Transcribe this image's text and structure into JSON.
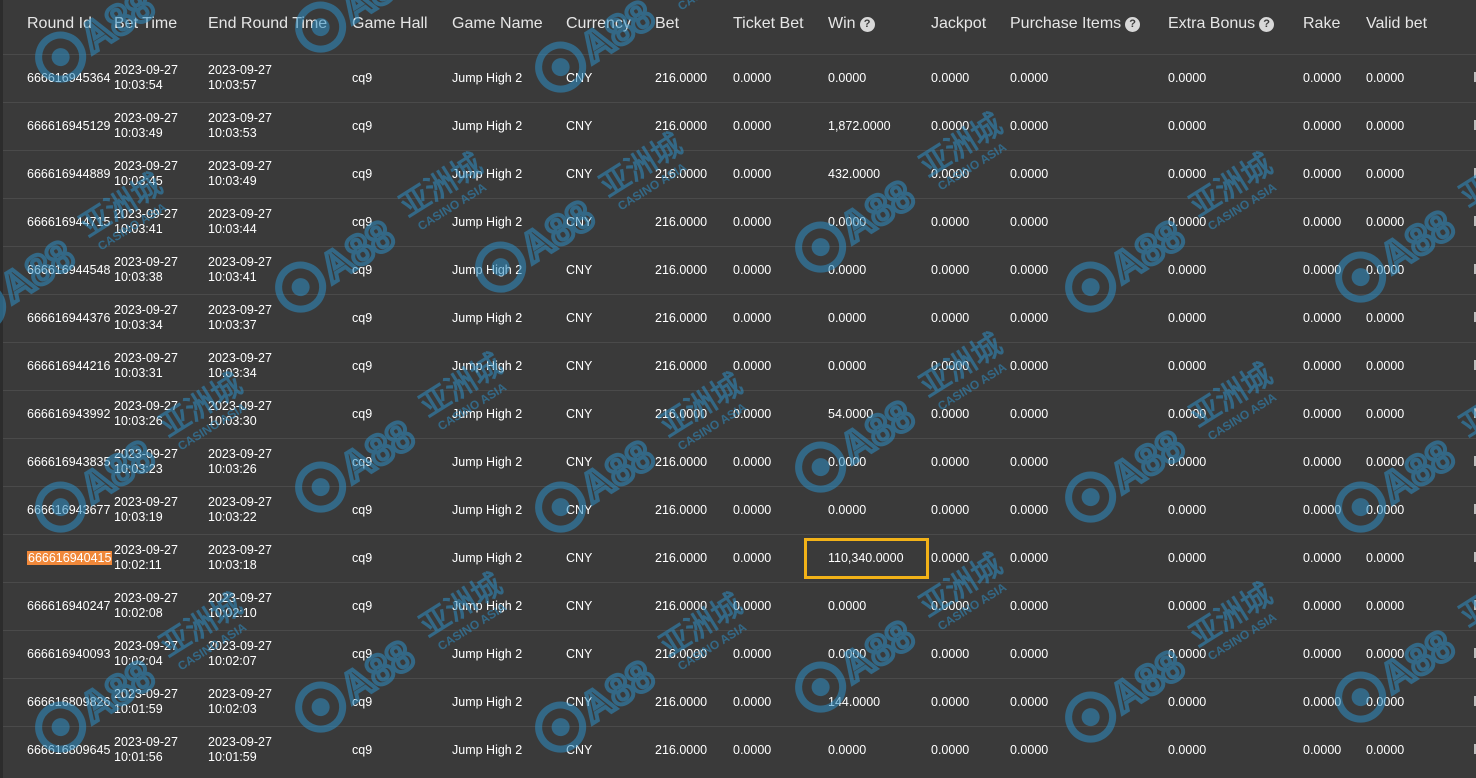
{
  "table": {
    "columns": [
      {
        "label": "Round Id",
        "help": false
      },
      {
        "label": "Bet Time",
        "help": false
      },
      {
        "label": "End Round Time",
        "help": false
      },
      {
        "label": "Game Hall",
        "help": false
      },
      {
        "label": "Game Name",
        "help": false
      },
      {
        "label": "Currency",
        "help": false
      },
      {
        "label": "Bet",
        "help": false
      },
      {
        "label": "Ticket Bet",
        "help": false
      },
      {
        "label": "Win",
        "help": true
      },
      {
        "label": "Jackpot",
        "help": false
      },
      {
        "label": "Purchase Items",
        "help": true
      },
      {
        "label": "Extra Bonus",
        "help": true
      },
      {
        "label": "Rake",
        "help": false
      },
      {
        "label": "Valid bet",
        "help": false
      }
    ],
    "help_glyph": "?",
    "rows": [
      {
        "round_id": "666616945364",
        "bet_date": "2023-09-27",
        "bet_clock": "10:03:54",
        "end_date": "2023-09-27",
        "end_clock": "10:03:57",
        "hall": "cq9",
        "game": "Jump High 2",
        "currency": "CNY",
        "bet": "216.0000",
        "ticket_bet": "0.0000",
        "win": "0.0000",
        "jackpot": "0.0000",
        "purchase": "0.0000",
        "extra_bonus": "0.0000",
        "rake": "0.0000",
        "valid_bet": "0.0000"
      },
      {
        "round_id": "666616945129",
        "bet_date": "2023-09-27",
        "bet_clock": "10:03:49",
        "end_date": "2023-09-27",
        "end_clock": "10:03:53",
        "hall": "cq9",
        "game": "Jump High 2",
        "currency": "CNY",
        "bet": "216.0000",
        "ticket_bet": "0.0000",
        "win": "1,872.0000",
        "jackpot": "0.0000",
        "purchase": "0.0000",
        "extra_bonus": "0.0000",
        "rake": "0.0000",
        "valid_bet": "0.0000"
      },
      {
        "round_id": "666616944889",
        "bet_date": "2023-09-27",
        "bet_clock": "10:03:45",
        "end_date": "2023-09-27",
        "end_clock": "10:03:49",
        "hall": "cq9",
        "game": "Jump High 2",
        "currency": "CNY",
        "bet": "216.0000",
        "ticket_bet": "0.0000",
        "win": "432.0000",
        "jackpot": "0.0000",
        "purchase": "0.0000",
        "extra_bonus": "0.0000",
        "rake": "0.0000",
        "valid_bet": "0.0000"
      },
      {
        "round_id": "666616944715",
        "bet_date": "2023-09-27",
        "bet_clock": "10:03:41",
        "end_date": "2023-09-27",
        "end_clock": "10:03:44",
        "hall": "cq9",
        "game": "Jump High 2",
        "currency": "CNY",
        "bet": "216.0000",
        "ticket_bet": "0.0000",
        "win": "0.0000",
        "jackpot": "0.0000",
        "purchase": "0.0000",
        "extra_bonus": "0.0000",
        "rake": "0.0000",
        "valid_bet": "0.0000"
      },
      {
        "round_id": "666616944548",
        "bet_date": "2023-09-27",
        "bet_clock": "10:03:38",
        "end_date": "2023-09-27",
        "end_clock": "10:03:41",
        "hall": "cq9",
        "game": "Jump High 2",
        "currency": "CNY",
        "bet": "216.0000",
        "ticket_bet": "0.0000",
        "win": "0.0000",
        "jackpot": "0.0000",
        "purchase": "0.0000",
        "extra_bonus": "0.0000",
        "rake": "0.0000",
        "valid_bet": "0.0000"
      },
      {
        "round_id": "666616944376",
        "bet_date": "2023-09-27",
        "bet_clock": "10:03:34",
        "end_date": "2023-09-27",
        "end_clock": "10:03:37",
        "hall": "cq9",
        "game": "Jump High 2",
        "currency": "CNY",
        "bet": "216.0000",
        "ticket_bet": "0.0000",
        "win": "0.0000",
        "jackpot": "0.0000",
        "purchase": "0.0000",
        "extra_bonus": "0.0000",
        "rake": "0.0000",
        "valid_bet": "0.0000"
      },
      {
        "round_id": "666616944216",
        "bet_date": "2023-09-27",
        "bet_clock": "10:03:31",
        "end_date": "2023-09-27",
        "end_clock": "10:03:34",
        "hall": "cq9",
        "game": "Jump High 2",
        "currency": "CNY",
        "bet": "216.0000",
        "ticket_bet": "0.0000",
        "win": "0.0000",
        "jackpot": "0.0000",
        "purchase": "0.0000",
        "extra_bonus": "0.0000",
        "rake": "0.0000",
        "valid_bet": "0.0000"
      },
      {
        "round_id": "666616943992",
        "bet_date": "2023-09-27",
        "bet_clock": "10:03:26",
        "end_date": "2023-09-27",
        "end_clock": "10:03:30",
        "hall": "cq9",
        "game": "Jump High 2",
        "currency": "CNY",
        "bet": "216.0000",
        "ticket_bet": "0.0000",
        "win": "54.0000",
        "jackpot": "0.0000",
        "purchase": "0.0000",
        "extra_bonus": "0.0000",
        "rake": "0.0000",
        "valid_bet": "0.0000"
      },
      {
        "round_id": "666616943835",
        "bet_date": "2023-09-27",
        "bet_clock": "10:03:23",
        "end_date": "2023-09-27",
        "end_clock": "10:03:26",
        "hall": "cq9",
        "game": "Jump High 2",
        "currency": "CNY",
        "bet": "216.0000",
        "ticket_bet": "0.0000",
        "win": "0.0000",
        "jackpot": "0.0000",
        "purchase": "0.0000",
        "extra_bonus": "0.0000",
        "rake": "0.0000",
        "valid_bet": "0.0000"
      },
      {
        "round_id": "666616943677",
        "bet_date": "2023-09-27",
        "bet_clock": "10:03:19",
        "end_date": "2023-09-27",
        "end_clock": "10:03:22",
        "hall": "cq9",
        "game": "Jump High 2",
        "currency": "CNY",
        "bet": "216.0000",
        "ticket_bet": "0.0000",
        "win": "0.0000",
        "jackpot": "0.0000",
        "purchase": "0.0000",
        "extra_bonus": "0.0000",
        "rake": "0.0000",
        "valid_bet": "0.0000"
      },
      {
        "round_id": "666616940415",
        "bet_date": "2023-09-27",
        "bet_clock": "10:02:11",
        "end_date": "2023-09-27",
        "end_clock": "10:03:18",
        "hall": "cq9",
        "game": "Jump High 2",
        "currency": "CNY",
        "bet": "216.0000",
        "ticket_bet": "0.0000",
        "win": "110,340.0000",
        "jackpot": "0.0000",
        "purchase": "0.0000",
        "extra_bonus": "0.0000",
        "rake": "0.0000",
        "valid_bet": "0.0000",
        "highlight_id": true,
        "highlight_win": true
      },
      {
        "round_id": "666616940247",
        "bet_date": "2023-09-27",
        "bet_clock": "10:02:08",
        "end_date": "2023-09-27",
        "end_clock": "10:02:10",
        "hall": "cq9",
        "game": "Jump High 2",
        "currency": "CNY",
        "bet": "216.0000",
        "ticket_bet": "0.0000",
        "win": "0.0000",
        "jackpot": "0.0000",
        "purchase": "0.0000",
        "extra_bonus": "0.0000",
        "rake": "0.0000",
        "valid_bet": "0.0000"
      },
      {
        "round_id": "666616940093",
        "bet_date": "2023-09-27",
        "bet_clock": "10:02:04",
        "end_date": "2023-09-27",
        "end_clock": "10:02:07",
        "hall": "cq9",
        "game": "Jump High 2",
        "currency": "CNY",
        "bet": "216.0000",
        "ticket_bet": "0.0000",
        "win": "0.0000",
        "jackpot": "0.0000",
        "purchase": "0.0000",
        "extra_bonus": "0.0000",
        "rake": "0.0000",
        "valid_bet": "0.0000"
      },
      {
        "round_id": "666616809826",
        "bet_date": "2023-09-27",
        "bet_clock": "10:01:59",
        "end_date": "2023-09-27",
        "end_clock": "10:02:03",
        "hall": "cq9",
        "game": "Jump High 2",
        "currency": "CNY",
        "bet": "216.0000",
        "ticket_bet": "0.0000",
        "win": "144.0000",
        "jackpot": "0.0000",
        "purchase": "0.0000",
        "extra_bonus": "0.0000",
        "rake": "0.0000",
        "valid_bet": "0.0000"
      },
      {
        "round_id": "666616809645",
        "bet_date": "2023-09-27",
        "bet_clock": "10:01:56",
        "end_date": "2023-09-27",
        "end_clock": "10:01:59",
        "hall": "cq9",
        "game": "Jump High 2",
        "currency": "CNY",
        "bet": "216.0000",
        "ticket_bet": "0.0000",
        "win": "0.0000",
        "jackpot": "0.0000",
        "purchase": "0.0000",
        "extra_bonus": "0.0000",
        "rake": "0.0000",
        "valid_bet": "0.0000"
      }
    ]
  },
  "watermark": {
    "logo_text": "CA88",
    "chinese_text": "亚洲城",
    "english_text": "CASINO ASIA",
    "color": "#2f8fc4"
  },
  "colors": {
    "background": "#3a3a3a",
    "id_highlight": "#f0883a",
    "win_highlight_border": "#f2b218"
  }
}
